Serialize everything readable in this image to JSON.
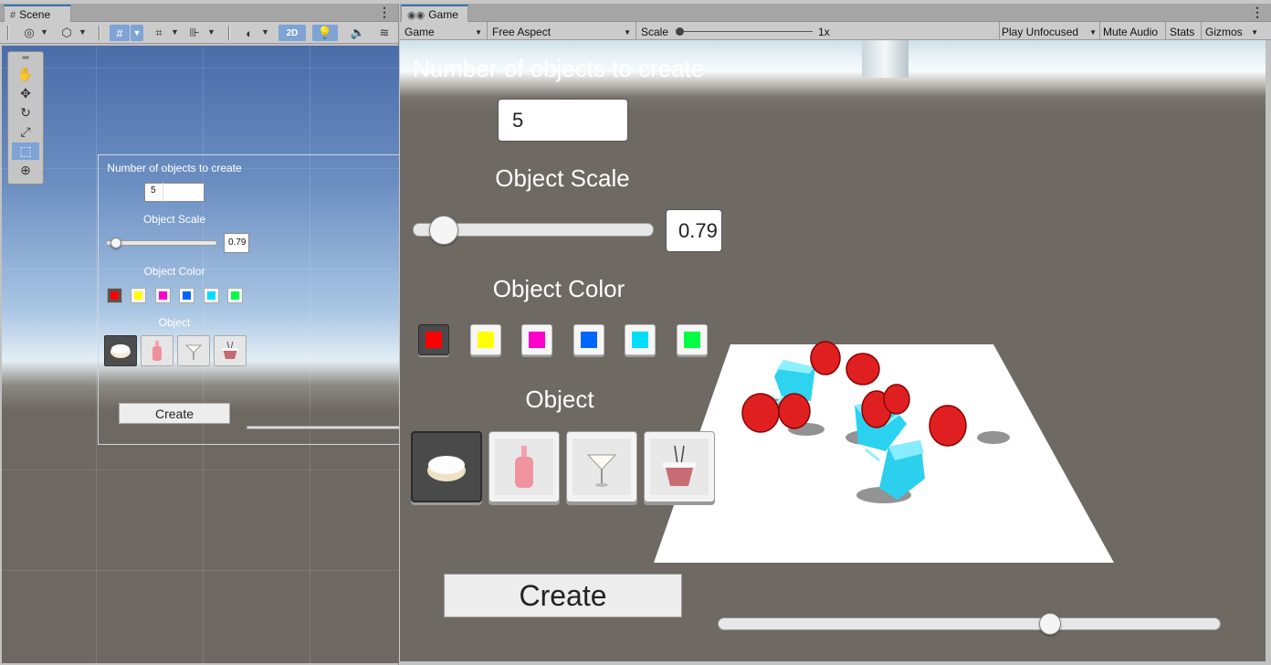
{
  "scene": {
    "tab_label": "Scene",
    "toolbar": {
      "mode_2d": "2D"
    },
    "ui": {
      "count_label": "Number of objects to create",
      "count_value": "5",
      "scale_label": "Object Scale",
      "scale_value": "0.79",
      "scale_level": 0.09,
      "color_label": "Object Color",
      "object_label": "Object",
      "create_label": "Create"
    }
  },
  "game": {
    "tab_label": "Game",
    "toolbar": {
      "display": "Game",
      "aspect": "Free Aspect",
      "scale_label": "Scale",
      "scale_value": "1x",
      "play_mode": "Play Unfocused",
      "mute": "Mute Audio",
      "stats": "Stats",
      "gizmos": "Gizmos"
    },
    "ui": {
      "count_label": "Number of objects to create",
      "count_value": "5",
      "scale_label": "Object Scale",
      "scale_value": "0.79",
      "scale_level": 0.13,
      "color_label": "Object Color",
      "object_label": "Object",
      "create_label": "Create",
      "camera_slider_level": 0.66
    }
  },
  "colors": [
    "#ff0000",
    "#ffff00",
    "#ff00cc",
    "#0066ff",
    "#00ddff",
    "#00ff44"
  ],
  "objects": [
    "pie-icon",
    "bottle-icon",
    "cocktail-icon",
    "noodle-box-icon"
  ]
}
